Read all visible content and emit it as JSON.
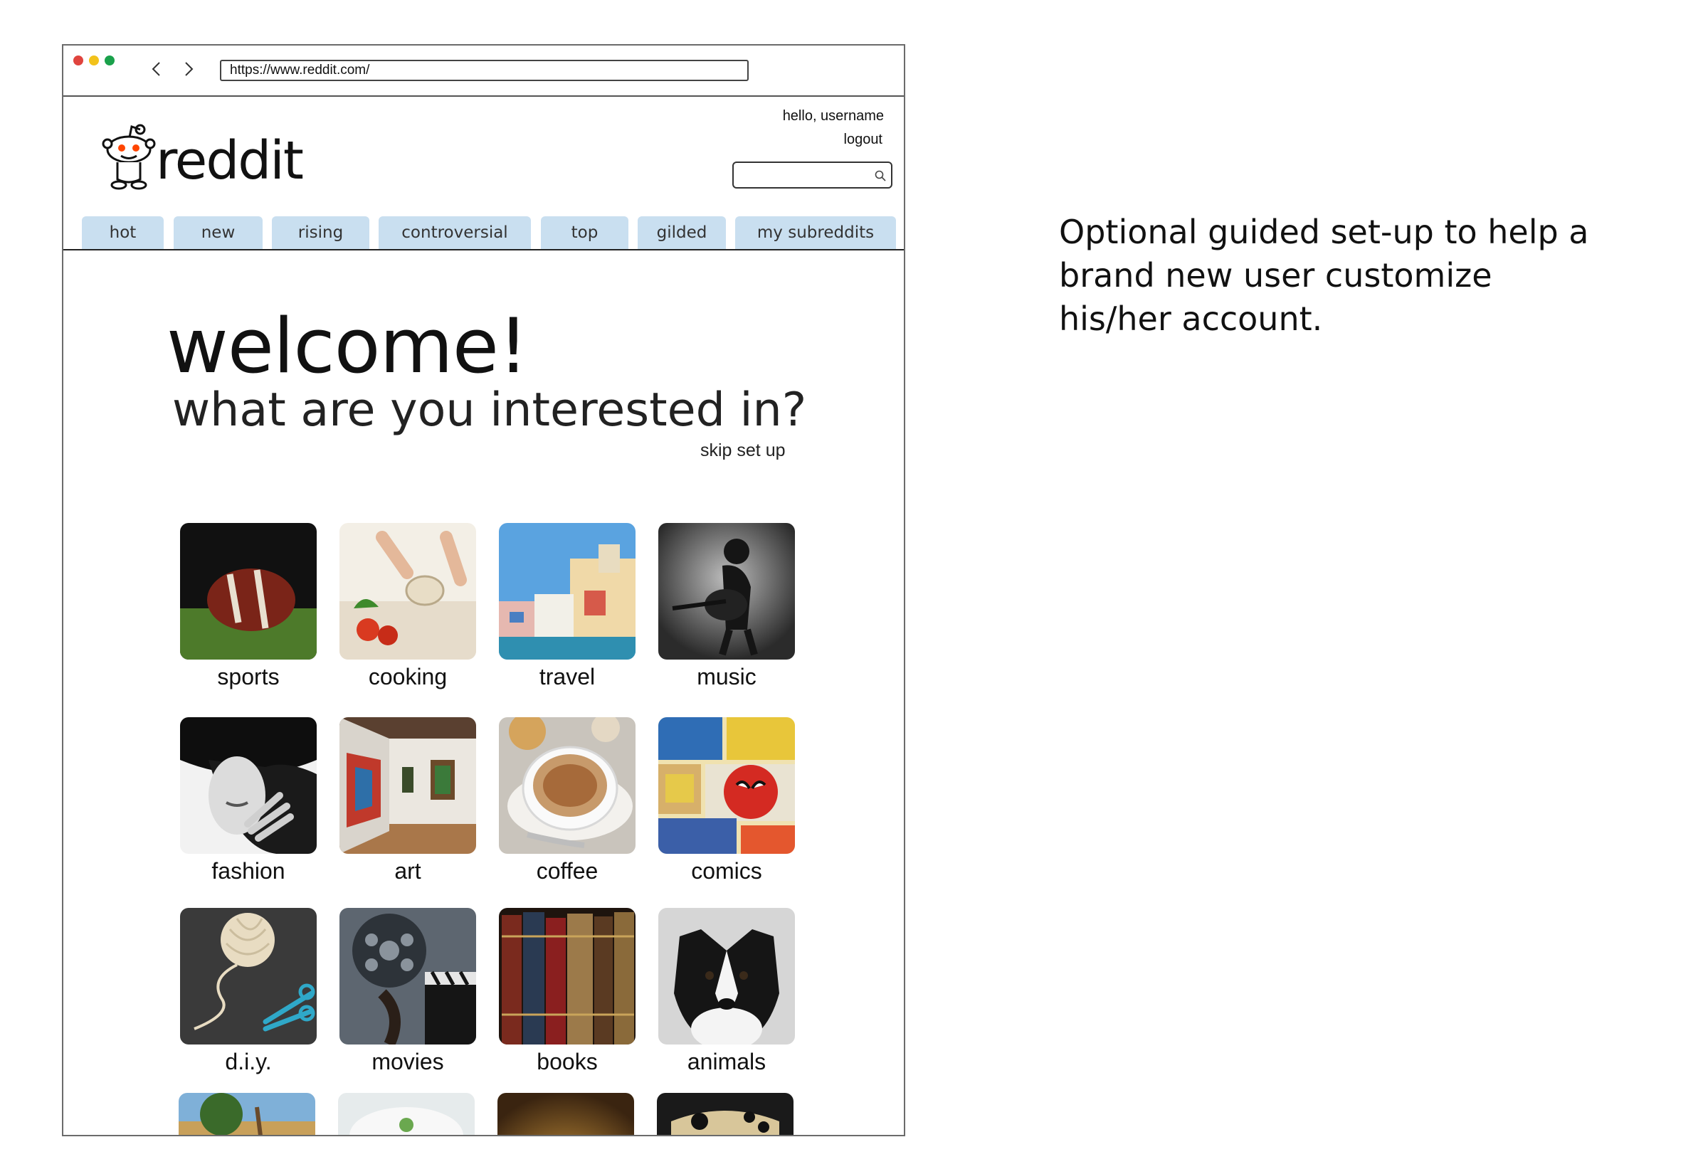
{
  "browser": {
    "url": "https://www.reddit.com/"
  },
  "header": {
    "wordmark": "reddit",
    "greeting": "hello, username",
    "logout": "logout",
    "search_placeholder": ""
  },
  "tabs": [
    {
      "label": "hot"
    },
    {
      "label": "new"
    },
    {
      "label": "rising"
    },
    {
      "label": "controversial"
    },
    {
      "label": "top"
    },
    {
      "label": "gilded"
    },
    {
      "label": "my subreddits"
    }
  ],
  "setup": {
    "title": "welcome!",
    "question": "what are you interested in?",
    "skip": "skip set up",
    "interests": [
      {
        "label": "sports"
      },
      {
        "label": "cooking"
      },
      {
        "label": "travel"
      },
      {
        "label": "music"
      },
      {
        "label": "fashion"
      },
      {
        "label": "art"
      },
      {
        "label": "coffee"
      },
      {
        "label": "comics"
      },
      {
        "label": "d.i.y."
      },
      {
        "label": "movies"
      },
      {
        "label": "books"
      },
      {
        "label": "animals"
      }
    ]
  },
  "annotation": "Optional guided set-up to help a brand new user customize his/her account.",
  "colors": {
    "tab_bg": "#c9dff0",
    "dot_red": "#e0443e",
    "dot_yellow": "#f2c21b",
    "dot_green": "#1aa14b"
  }
}
